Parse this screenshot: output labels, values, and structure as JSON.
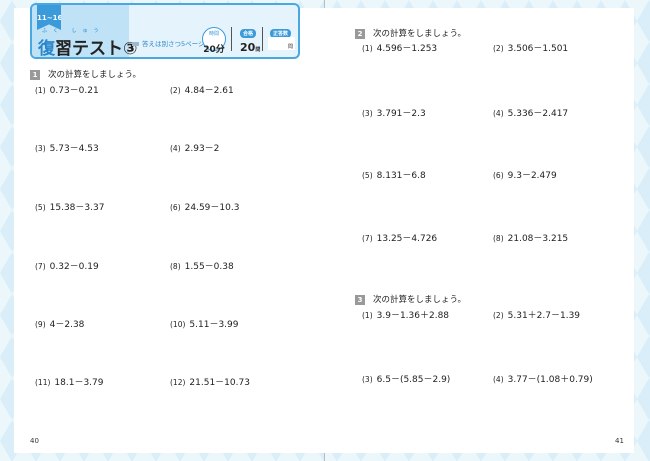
{
  "header": {
    "tag": "11~16",
    "title_first": "復",
    "title_rest": "習テスト③",
    "ruby": "ふく しゅう",
    "answer_note": "答えは別さつ5ページ",
    "time_label": "時間",
    "time_value": "20分",
    "pass_label": "合格",
    "pass_value": "20",
    "pass_unit": "問",
    "score_label": "正答数",
    "score_unit": "問"
  },
  "left": {
    "page_number": "40",
    "section1": {
      "number": "1",
      "instruction": "次の計算をしましょう。",
      "problems": [
        {
          "n": "(1)",
          "expr": "0.73－0.21"
        },
        {
          "n": "(2)",
          "expr": "4.84－2.61"
        },
        {
          "n": "(3)",
          "expr": "5.73－4.53"
        },
        {
          "n": "(4)",
          "expr": "2.93－2"
        },
        {
          "n": "(5)",
          "expr": "15.38－3.37"
        },
        {
          "n": "(6)",
          "expr": "24.59－10.3"
        },
        {
          "n": "(7)",
          "expr": "0.32－0.19"
        },
        {
          "n": "(8)",
          "expr": "1.55－0.38"
        },
        {
          "n": "(9)",
          "expr": "4－2.38"
        },
        {
          "n": "(10)",
          "expr": "5.11－3.99"
        },
        {
          "n": "(11)",
          "expr": "18.1－3.79"
        },
        {
          "n": "(12)",
          "expr": "21.51－10.73"
        }
      ]
    }
  },
  "right": {
    "page_number": "41",
    "section2": {
      "number": "2",
      "instruction": "次の計算をしましょう。",
      "problems": [
        {
          "n": "(1)",
          "expr": "4.596－1.253"
        },
        {
          "n": "(2)",
          "expr": "3.506－1.501"
        },
        {
          "n": "(3)",
          "expr": "3.791－2.3"
        },
        {
          "n": "(4)",
          "expr": "5.336－2.417"
        },
        {
          "n": "(5)",
          "expr": "8.131－6.8"
        },
        {
          "n": "(6)",
          "expr": "9.3－2.479"
        },
        {
          "n": "(7)",
          "expr": "13.25－4.726"
        },
        {
          "n": "(8)",
          "expr": "21.08－3.215"
        }
      ]
    },
    "section3": {
      "number": "3",
      "instruction": "次の計算をしましょう。",
      "problems": [
        {
          "n": "(1)",
          "expr": "3.9－1.36＋2.88"
        },
        {
          "n": "(2)",
          "expr": "5.31＋2.7－1.39"
        },
        {
          "n": "(3)",
          "expr": "6.5－(5.85－2.9)"
        },
        {
          "n": "(4)",
          "expr": "3.77－(1.08＋0.79)"
        }
      ]
    }
  }
}
